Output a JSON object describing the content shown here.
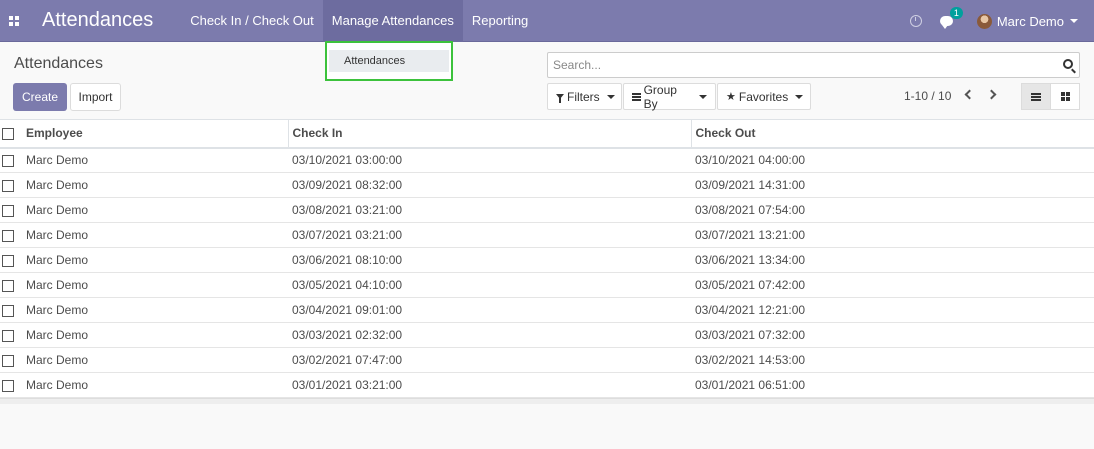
{
  "navbar": {
    "apps_icon": "apps-grid-icon",
    "brand": "Attendances",
    "menu": [
      {
        "label": "Check In / Check Out"
      },
      {
        "label": "Manage Attendances"
      },
      {
        "label": "Reporting"
      }
    ],
    "chat_badge": "1",
    "user_name": "Marc Demo"
  },
  "dropdown": {
    "items": [
      {
        "label": "Attendances"
      }
    ]
  },
  "control_panel": {
    "title": "Attendances",
    "create_label": "Create",
    "import_label": "Import",
    "search_placeholder": "Search...",
    "filters_label": "Filters",
    "groupby_label": "Group By",
    "favorites_label": "Favorites",
    "pager": "1-10 / 10"
  },
  "table": {
    "headers": [
      "Employee",
      "Check In",
      "Check Out"
    ],
    "rows": [
      {
        "employee": "Marc Demo",
        "check_in": "03/10/2021 03:00:00",
        "check_out": "03/10/2021 04:00:00"
      },
      {
        "employee": "Marc Demo",
        "check_in": "03/09/2021 08:32:00",
        "check_out": "03/09/2021 14:31:00"
      },
      {
        "employee": "Marc Demo",
        "check_in": "03/08/2021 03:21:00",
        "check_out": "03/08/2021 07:54:00"
      },
      {
        "employee": "Marc Demo",
        "check_in": "03/07/2021 03:21:00",
        "check_out": "03/07/2021 13:21:00"
      },
      {
        "employee": "Marc Demo",
        "check_in": "03/06/2021 08:10:00",
        "check_out": "03/06/2021 13:34:00"
      },
      {
        "employee": "Marc Demo",
        "check_in": "03/05/2021 04:10:00",
        "check_out": "03/05/2021 07:42:00"
      },
      {
        "employee": "Marc Demo",
        "check_in": "03/04/2021 09:01:00",
        "check_out": "03/04/2021 12:21:00"
      },
      {
        "employee": "Marc Demo",
        "check_in": "03/03/2021 02:32:00",
        "check_out": "03/03/2021 07:32:00"
      },
      {
        "employee": "Marc Demo",
        "check_in": "03/02/2021 07:47:00",
        "check_out": "03/02/2021 14:53:00"
      },
      {
        "employee": "Marc Demo",
        "check_in": "03/01/2021 03:21:00",
        "check_out": "03/01/2021 06:51:00"
      }
    ]
  },
  "colors": {
    "navbar": "#7c7bad",
    "highlight": "#3cc23c",
    "badge": "#00a09d"
  }
}
